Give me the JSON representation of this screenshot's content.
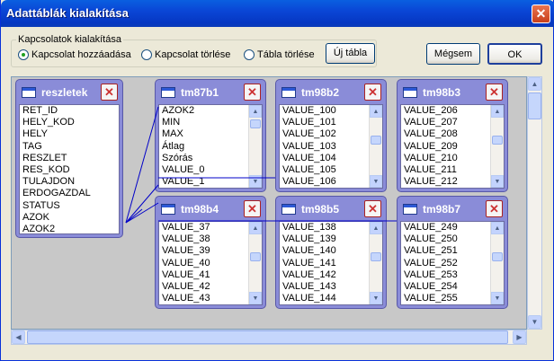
{
  "window": {
    "title": "Adattáblák kialakítása",
    "close_glyph": "✕"
  },
  "group": {
    "legend": "Kapcsolatok kialakítása",
    "options": [
      {
        "label": "Kapcsolat hozzáadása",
        "checked": true
      },
      {
        "label": "Kapcsolat törlése",
        "checked": false
      },
      {
        "label": "Tábla törlése",
        "checked": false
      }
    ]
  },
  "buttons": {
    "new_table": "Új tábla",
    "cancel": "Mégsem",
    "ok": "OK"
  },
  "tables": [
    {
      "name": "reszletek",
      "rows": [
        "RET_ID",
        "HELY_KOD",
        "HELY",
        "TAG",
        "RESZLET",
        "RES_KOD",
        "TULAJDON",
        "ERDOGAZDAL",
        "STATUS",
        "AZOK",
        "AZOK2"
      ]
    },
    {
      "name": "tm87b1",
      "rows": [
        "AZOK2",
        "MIN",
        "MAX",
        "Átlag",
        "Szórás",
        "VALUE_0",
        "VALUE_1"
      ]
    },
    {
      "name": "tm98b2",
      "rows": [
        "VALUE_100",
        "VALUE_101",
        "VALUE_102",
        "VALUE_103",
        "VALUE_104",
        "VALUE_105",
        "VALUE_106"
      ]
    },
    {
      "name": "tm98b3",
      "rows": [
        "VALUE_206",
        "VALUE_207",
        "VALUE_208",
        "VALUE_209",
        "VALUE_210",
        "VALUE_211",
        "VALUE_212"
      ]
    },
    {
      "name": "tm98b4",
      "rows": [
        "VALUE_37",
        "VALUE_38",
        "VALUE_39",
        "VALUE_40",
        "VALUE_41",
        "VALUE_42",
        "VALUE_43"
      ]
    },
    {
      "name": "tm98b5",
      "rows": [
        "VALUE_138",
        "VALUE_139",
        "VALUE_140",
        "VALUE_141",
        "VALUE_142",
        "VALUE_143",
        "VALUE_144"
      ]
    },
    {
      "name": "tm98b7",
      "rows": [
        "VALUE_249",
        "VALUE_250",
        "VALUE_251",
        "VALUE_252",
        "VALUE_253",
        "VALUE_254",
        "VALUE_255"
      ]
    }
  ],
  "colors": {
    "title_bar": "#0a46d6",
    "table_header": "#8a8cd8",
    "link_line": "#0000c8"
  }
}
